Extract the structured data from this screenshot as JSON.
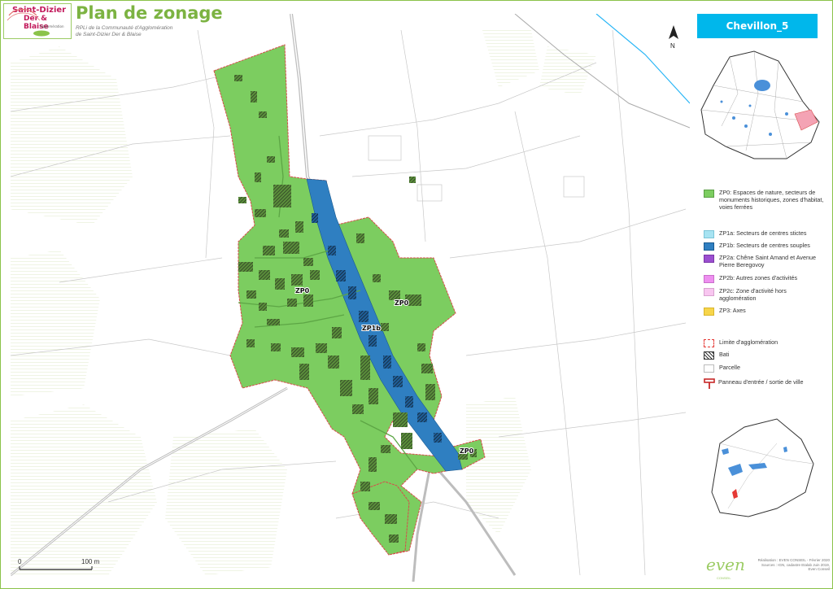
{
  "header": {
    "logo_line1": "Saint-Dizier",
    "logo_line2": "Der & Blaise",
    "logo_line3": "Agglomération",
    "title": "Plan de zonage",
    "subtitle_line1": "RPLi de la Communauté d'Agglomération",
    "subtitle_line2": "de Saint-Dizier Der & Blaise"
  },
  "map": {
    "zone_labels": [
      "ZP0",
      "ZP0",
      "ZP1b",
      "ZP0"
    ],
    "north_label": "N",
    "scale_start": "0",
    "scale_end": "100 m"
  },
  "panel": {
    "sheet_title": "Chevillon_5"
  },
  "legend": {
    "items": [
      {
        "label": "ZP0: Espaces de nature, secteurs de monuments historiques, zones d'habitat, voies ferrées",
        "color": "#7ccd60",
        "kind": "fill"
      },
      {
        "label": "ZP1a: Secteurs de centres stictes",
        "color": "#a7e3f2",
        "kind": "fill"
      },
      {
        "label": "ZP1b: Secteurs de centres souples",
        "color": "#2f7fc1",
        "kind": "fill"
      },
      {
        "label": "ZP2a: Chêne Saint Amand et Avenue Pierre Beregovoy",
        "color": "#9b4fd0",
        "kind": "fill"
      },
      {
        "label": "ZP2b: Autres zones d'activités",
        "color": "#ee8ff0",
        "kind": "fill"
      },
      {
        "label": "ZP2c: Zone d'activité hors agglomération",
        "color": "#f8c6f0",
        "kind": "fill"
      },
      {
        "label": "ZP3: Axes",
        "color": "#f7d54a",
        "kind": "fill"
      },
      {
        "label": "Limite d'agglomération",
        "color": "#e53935",
        "kind": "dashed"
      },
      {
        "label": "Bati",
        "color": "#333333",
        "kind": "hatch"
      },
      {
        "label": "Parcelle",
        "color": "#bbbbbb",
        "kind": "outline"
      },
      {
        "label": "Panneau d'entrée / sortie de ville",
        "color": "#c62828",
        "kind": "sign"
      }
    ]
  },
  "credits": {
    "line1": "Réalisation : EVEN CONSEIL - Février 2020",
    "line2": "Sources : IGN, cadastre Etalab Juin 2019,",
    "line3": "Even Conseil",
    "brand": "even",
    "brand_sub": "CONSEIL"
  }
}
